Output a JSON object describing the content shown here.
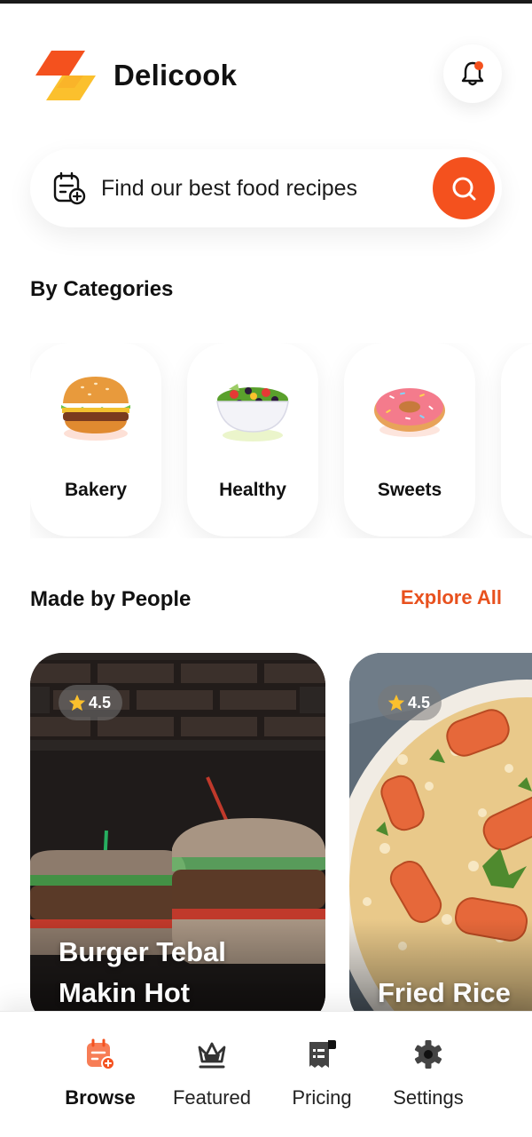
{
  "app": {
    "name": "Delicook"
  },
  "header": {
    "notification_icon": "bell-icon",
    "has_unread": true
  },
  "search": {
    "placeholder": "Find our best food recipes",
    "left_icon": "calendar-add-icon",
    "button_icon": "search-icon"
  },
  "categories": {
    "title": "By Categories",
    "items": [
      {
        "label": "Bakery",
        "icon": "burger-icon"
      },
      {
        "label": "Healthy",
        "icon": "salad-bowl-icon"
      },
      {
        "label": "Sweets",
        "icon": "donut-icon"
      }
    ]
  },
  "made_by_people": {
    "title": "Made by People",
    "explore_label": "Explore All",
    "recipes": [
      {
        "name": "Burger Tebal Makin Hot",
        "rating": "4.5"
      },
      {
        "name": "Fried Rice",
        "rating": "4.5"
      }
    ]
  },
  "bottom_nav": {
    "items": [
      {
        "label": "Browse",
        "icon": "calendar-icon",
        "active": true
      },
      {
        "label": "Featured",
        "icon": "crown-icon",
        "active": false
      },
      {
        "label": "Pricing",
        "icon": "receipt-icon",
        "active": false
      },
      {
        "label": "Settings",
        "icon": "gear-icon",
        "active": false
      }
    ]
  },
  "colors": {
    "accent": "#f4511e",
    "accent_text": "#e8511e",
    "logo_red": "#f4511e",
    "logo_yellow": "#fbc02d"
  }
}
